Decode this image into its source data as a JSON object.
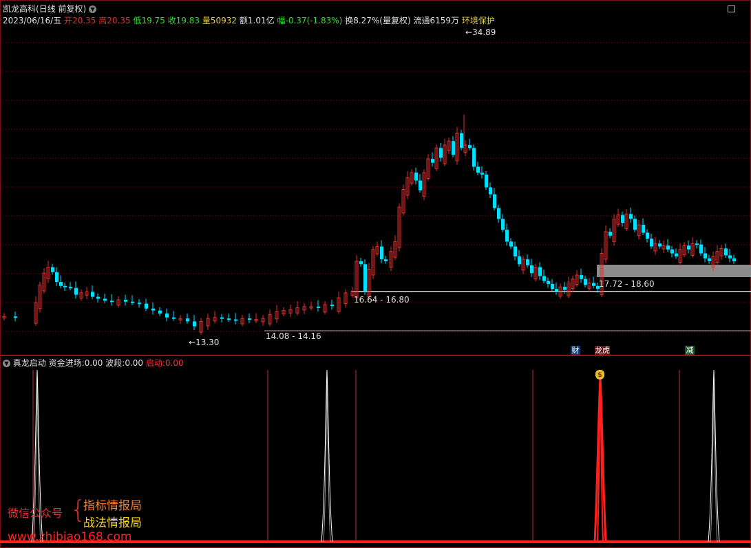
{
  "title_bar": {
    "stock_name": "凯龙高科",
    "period_label": "(日线 前复权)"
  },
  "quote": {
    "date": "2023/06/16/五",
    "open_label": "开",
    "open": "20.35",
    "high_label": "高",
    "high": "20.35",
    "low_label": "低",
    "low": "19.75",
    "close_label": "收",
    "close": "19.83",
    "volume_label": "量",
    "volume": "50932",
    "amount_label": "额",
    "amount": "1.01亿",
    "change_label": "幅",
    "change": "-0.37(-1.83%)",
    "turnover": "换8.27%(量复权)",
    "float_shares": "流通6159万",
    "env_tag": "环境保护"
  },
  "price_labels": {
    "peak": "34.89",
    "low": "13.30",
    "zone1": "14.08 - 14.16",
    "zone2": "16.64 - 16.80",
    "zone3": "17.72 - 18.60"
  },
  "event_badges": {
    "cai": "财",
    "longhu": "龙虎",
    "jian": "减"
  },
  "indicator": {
    "name": "真龙启动",
    "fund_label": "资金进场:",
    "fund_value": "0.00",
    "wave_label": "波段:",
    "wave_value": "0.00",
    "start_label": "启动:",
    "start_value": "0.00",
    "money_icon": "money-bag-icon"
  },
  "watermark": {
    "wechat": "微信公众号",
    "brace": "{",
    "line1": "指标情报局",
    "line2": "战法情报局",
    "url": "www.zhibiao168.com"
  },
  "colors": {
    "up": "#e03030",
    "down": "#00e0ff",
    "background": "#000000",
    "grid": "#7a1010",
    "zone_box": "#8c8c8c",
    "label_yellow": "#e8d040",
    "label_green": "#30e030",
    "signal_red": "#ff2020"
  },
  "chart_data": {
    "type": "candlestick",
    "peak_price": 34.89,
    "low_price": 13.3,
    "support_zones": [
      [
        14.08,
        14.16
      ],
      [
        16.64,
        16.8
      ],
      [
        17.72,
        18.6
      ]
    ]
  }
}
